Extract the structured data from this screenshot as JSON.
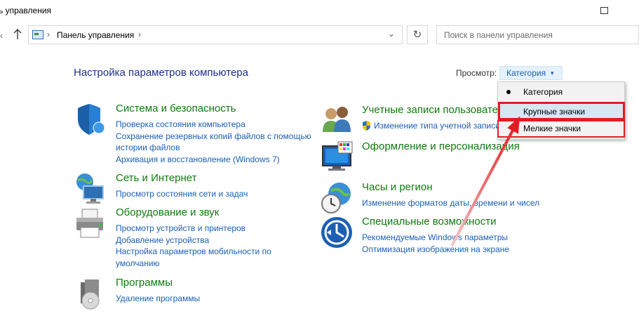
{
  "window": {
    "title": "ь управления"
  },
  "address_bar": {
    "breadcrumb": "Панель управления",
    "separator": "›",
    "dropdown_glyph": "⌄",
    "refresh_glyph": "↻",
    "back_glyph": "‹"
  },
  "search": {
    "placeholder": "Поиск в панели управления"
  },
  "header": {
    "title": "Настройка параметров компьютера",
    "view_by_label": "Просмотр:",
    "view_by_value": "Категория",
    "view_by_caret": "▾"
  },
  "left_categories": [
    {
      "title": "Система и безопасность",
      "icon": "shield-icon",
      "links": [
        "Проверка состояния компьютера",
        "Сохранение резервных копий файлов с помощью",
        "истории файлов",
        "Архивация и восстановление (Windows 7)"
      ]
    },
    {
      "title": "Сеть и Интернет",
      "icon": "network-icon",
      "links": [
        "Просмотр состояния сети и задач"
      ]
    },
    {
      "title": "Оборудование и звук",
      "icon": "printer-icon",
      "links": [
        "Просмотр устройств и принтеров",
        "Добавление устройства",
        "Настройка параметров мобильности по",
        "умолчанию"
      ]
    },
    {
      "title": "Программы",
      "icon": "programs-icon",
      "links": [
        "Удаление программы"
      ]
    }
  ],
  "right_categories": [
    {
      "title": "Учетные записи пользователей",
      "icon": "users-icon",
      "links": [
        "Изменение типа учетной записи"
      ]
    },
    {
      "title": "Оформление и персонализация",
      "icon": "personalization-icon",
      "links": []
    },
    {
      "title": "Часы и регион",
      "icon": "clock-icon",
      "links": [
        "Изменение форматов даты, времени и чисел"
      ]
    },
    {
      "title": "Специальные возможности",
      "icon": "accessibility-icon",
      "links": [
        "Рекомендуемые Windows параметры",
        "Оптимизация изображения на экране"
      ]
    }
  ],
  "view_menu": {
    "items": [
      "Категория",
      "Крупные значки",
      "Мелкие значки"
    ],
    "selected": "Категория",
    "highlighted": "Крупные значки"
  },
  "colors": {
    "category_title": "#0f7a0f",
    "link": "#1a5fb4",
    "page_title": "#1e3287",
    "annotation": "#e31b23"
  }
}
